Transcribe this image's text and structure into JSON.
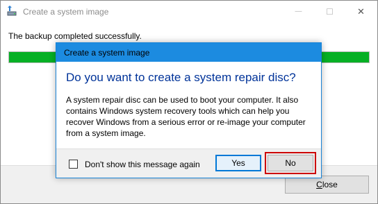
{
  "window": {
    "title": "Create a system image",
    "icon": "backup-drive-icon",
    "minimize_glyph": "—",
    "maximize_glyph": "☐",
    "close_glyph": "✕"
  },
  "main": {
    "status_text": "The backup completed successfully.",
    "progress_percent": 100,
    "progress_color": "#06b025"
  },
  "footer": {
    "close_label_mnemonic": "C",
    "close_label_rest": "lose"
  },
  "dialog": {
    "title": "Create a system image",
    "title_bar_color": "#1c8be0",
    "heading": "Do you want to create a system repair disc?",
    "body": "A system repair disc can be used to boot your computer. It also contains Windows system recovery tools which can help you recover Windows from a serious error or re-image your computer from a system image.",
    "checkbox_label": "Don't show this message again",
    "checkbox_checked": false,
    "yes_label": "Yes",
    "no_label": "No",
    "highlight_color": "#cc0000"
  }
}
